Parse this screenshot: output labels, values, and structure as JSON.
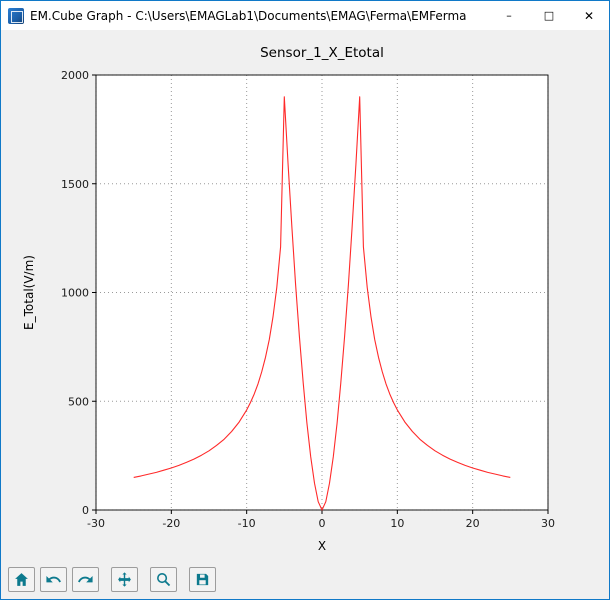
{
  "window": {
    "title": "EM.Cube Graph - C:\\Users\\EMAGLab1\\Documents\\EMAG\\Ferma\\EMFerma",
    "controls": {
      "minimize": "–",
      "maximize": "□",
      "close": "✕"
    }
  },
  "chart_data": {
    "type": "line",
    "title": "Sensor_1_X_Etotal",
    "xlabel": "X",
    "ylabel": "E_Total(V/m)",
    "xlim": [
      -30,
      30
    ],
    "ylim": [
      0,
      2000
    ],
    "xticks": [
      -30,
      -20,
      -10,
      0,
      10,
      20,
      30
    ],
    "yticks": [
      0,
      500,
      1000,
      1500,
      2000
    ],
    "grid": "dotted",
    "legend": "none",
    "series": [
      {
        "name": "E_Total",
        "color": "#ff2a2a",
        "points": [
          [
            -25,
            150
          ],
          [
            -24,
            157
          ],
          [
            -23,
            165
          ],
          [
            -22,
            173
          ],
          [
            -21,
            183
          ],
          [
            -20,
            193
          ],
          [
            -19,
            205
          ],
          [
            -18,
            219
          ],
          [
            -17,
            234
          ],
          [
            -16,
            252
          ],
          [
            -15,
            272
          ],
          [
            -14,
            297
          ],
          [
            -13,
            325
          ],
          [
            -12,
            361
          ],
          [
            -11,
            404
          ],
          [
            -10,
            460
          ],
          [
            -9.5,
            494
          ],
          [
            -9,
            533
          ],
          [
            -8.5,
            580
          ],
          [
            -8,
            635
          ],
          [
            -7.5,
            702
          ],
          [
            -7,
            784
          ],
          [
            -6.5,
            888
          ],
          [
            -6,
            1024
          ],
          [
            -5.5,
            1210
          ],
          [
            -5,
            1900
          ],
          [
            -4.5,
            1588
          ],
          [
            -4,
            1300
          ],
          [
            -3.5,
            1036
          ],
          [
            -3,
            798
          ],
          [
            -2.5,
            585
          ],
          [
            -2,
            400
          ],
          [
            -1.5,
            245
          ],
          [
            -1,
            123
          ],
          [
            -0.5,
            38
          ],
          [
            0,
            0
          ],
          [
            0.5,
            38
          ],
          [
            1,
            123
          ],
          [
            1.5,
            245
          ],
          [
            2,
            400
          ],
          [
            2.5,
            585
          ],
          [
            3,
            798
          ],
          [
            3.5,
            1036
          ],
          [
            4,
            1300
          ],
          [
            4.5,
            1588
          ],
          [
            5,
            1900
          ],
          [
            5.5,
            1210
          ],
          [
            6,
            1024
          ],
          [
            6.5,
            888
          ],
          [
            7,
            784
          ],
          [
            7.5,
            702
          ],
          [
            8,
            635
          ],
          [
            8.5,
            580
          ],
          [
            9,
            533
          ],
          [
            9.5,
            494
          ],
          [
            10,
            460
          ],
          [
            11,
            404
          ],
          [
            12,
            361
          ],
          [
            13,
            325
          ],
          [
            14,
            297
          ],
          [
            15,
            272
          ],
          [
            16,
            252
          ],
          [
            17,
            234
          ],
          [
            18,
            219
          ],
          [
            19,
            205
          ],
          [
            20,
            193
          ],
          [
            21,
            183
          ],
          [
            22,
            173
          ],
          [
            23,
            165
          ],
          [
            24,
            157
          ],
          [
            25,
            150
          ]
        ]
      }
    ]
  },
  "toolbar": {
    "icon_color": "#0d7a8e",
    "buttons": [
      {
        "name": "home",
        "tooltip": "Home"
      },
      {
        "name": "back",
        "tooltip": "Back"
      },
      {
        "name": "forward",
        "tooltip": "Forward"
      },
      {
        "name": "pan",
        "tooltip": "Pan"
      },
      {
        "name": "zoom",
        "tooltip": "Zoom"
      },
      {
        "name": "save",
        "tooltip": "Save"
      }
    ]
  }
}
